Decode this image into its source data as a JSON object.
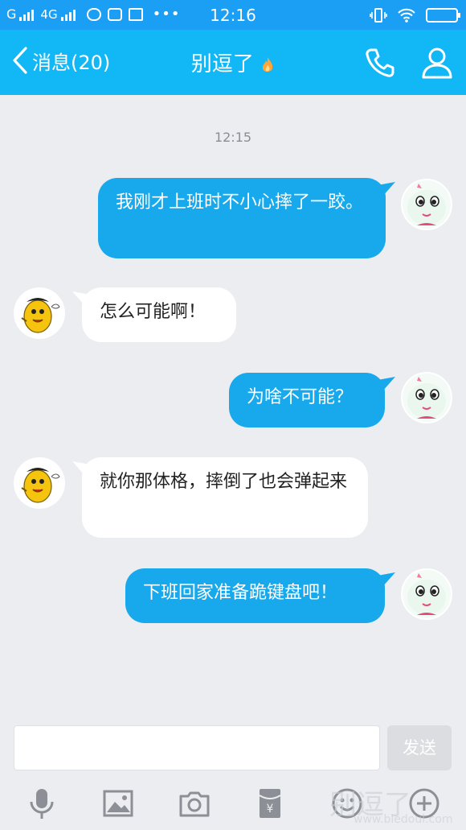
{
  "status_bar": {
    "carrier": "G",
    "network": "4G",
    "time": "12:16"
  },
  "header": {
    "back_label": "消息(20)",
    "title": "别逗了",
    "accent_color": "#12b7f5"
  },
  "chat": {
    "timestamp": "12:15",
    "messages": [
      {
        "from": "me",
        "text": "我刚才上班时不小心摔了一跤。"
      },
      {
        "from": "other",
        "text": "怎么可能啊！"
      },
      {
        "from": "me",
        "text": "为啥不可能？"
      },
      {
        "from": "other",
        "text": "就你那体格，摔倒了也会弹起来"
      },
      {
        "from": "me",
        "text": "下班回家准备跪键盘吧！"
      }
    ]
  },
  "input": {
    "value": "",
    "send_label": "发送"
  },
  "toolbar": {
    "icons": [
      "microphone-icon",
      "image-icon",
      "camera-icon",
      "red-packet-icon",
      "emoji-icon",
      "plus-icon"
    ]
  },
  "watermark": {
    "text": "别逗了",
    "url": "www.biedoul.com"
  }
}
